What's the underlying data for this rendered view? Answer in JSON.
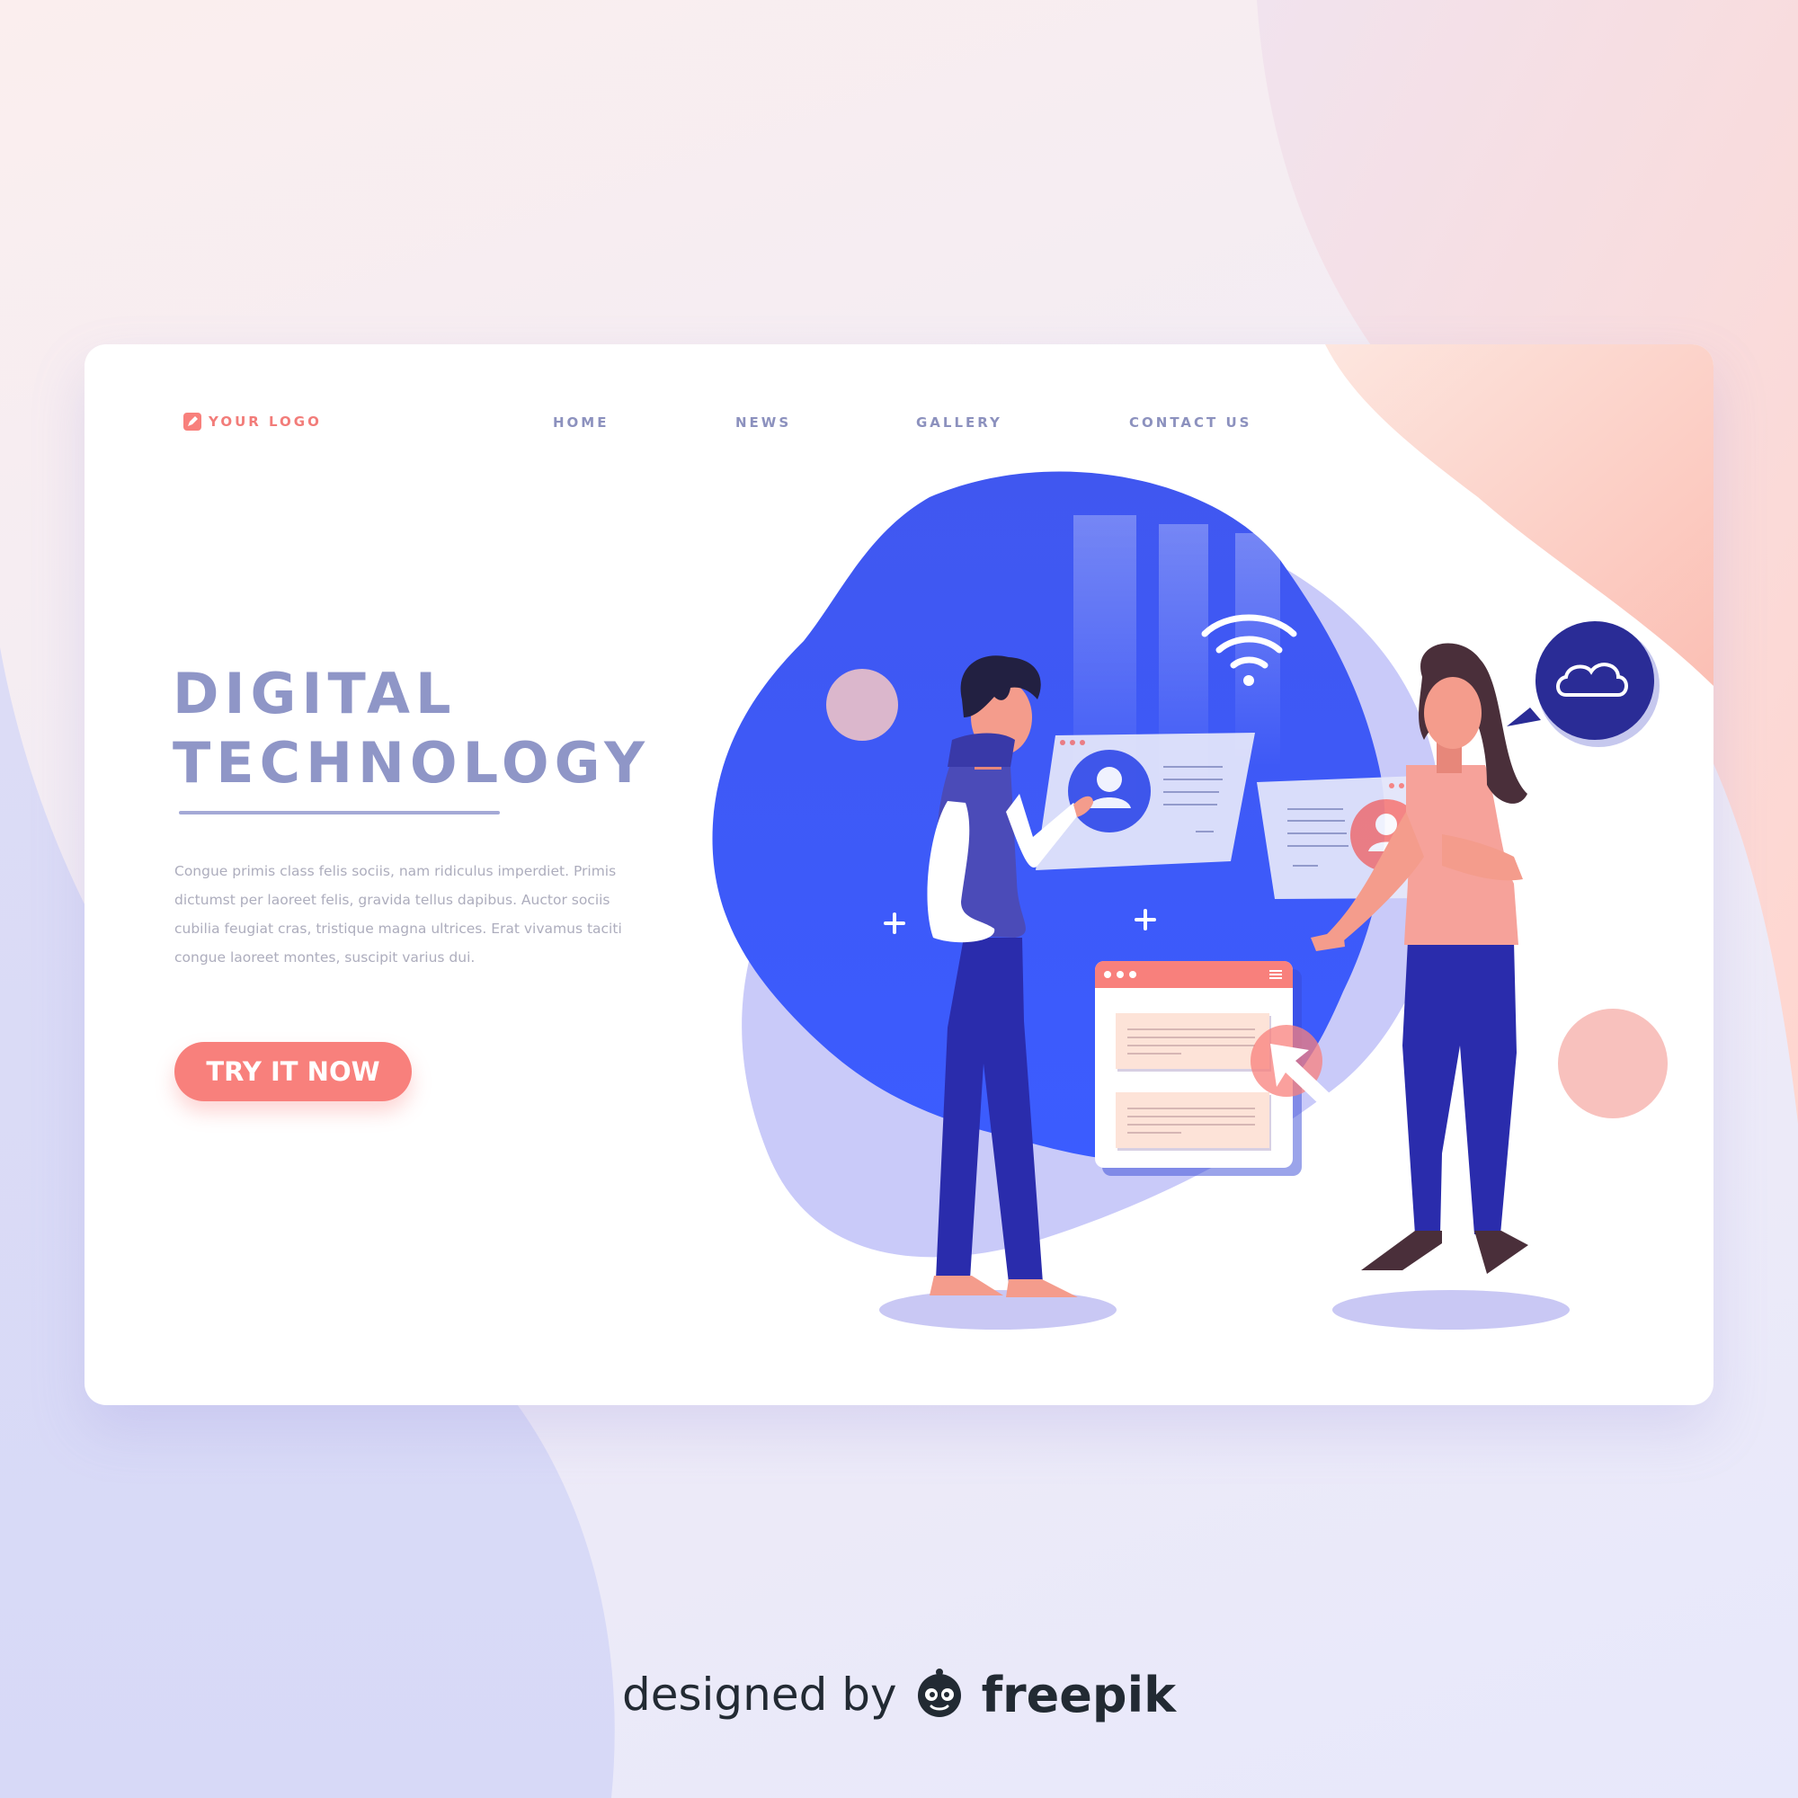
{
  "nav": {
    "logo_text": "YOUR LOGO",
    "links": [
      "HOME",
      "NEWS",
      "GALLERY",
      "CONTACT US"
    ]
  },
  "hero": {
    "title_line1": "DIGITAL",
    "title_line2": "TECHNOLOGY",
    "description": "Congue primis class felis sociis, nam ridiculus imperdiet. Primis dictumst per laoreet felis, gravida tellus dapibus. Auctor sociis cubilia feugiat cras, tristique magna ultrices. Erat vivamus taciti congue laoreet montes, suscipit varius dui.",
    "cta_label": "TRY IT NOW"
  },
  "footer": {
    "credit_prefix": "designed by",
    "credit_brand": "freepik"
  },
  "colors": {
    "accent": "#f8807c",
    "heading": "#8f96c7",
    "blob": "#3d55f2",
    "nav": "#8c91be",
    "dark_navy": "#2a2c96"
  },
  "icons": [
    "logo-icon",
    "wifi-icon",
    "cloud-icon",
    "user-avatar-icon",
    "cursor-arrow-icon",
    "plus-icon",
    "menu-icon",
    "freepik-logo-icon"
  ]
}
